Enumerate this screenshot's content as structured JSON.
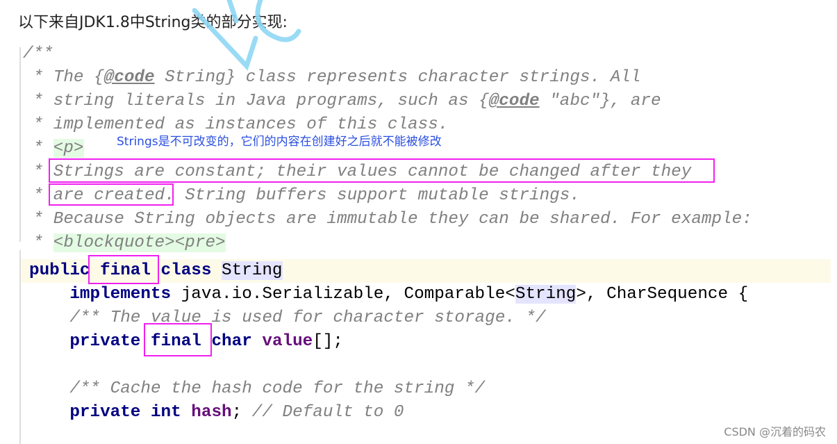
{
  "intro": "以下来自JDK1.8中String类的部分实现:",
  "annotation": "Strings是不可改变的，它们的内容在创建好之后就不能被修改",
  "footer": "CSDN @沉着的码农",
  "colors": {
    "highlight_box": "#f020f0",
    "annotation": "#2a4fe0",
    "keyword": "#000080",
    "comment": "#808080",
    "field": "#660e7a"
  },
  "javadoc": [
    [
      {
        "t": "/**",
        "c": "cm"
      }
    ],
    [
      {
        "t": " * The ",
        "c": "cm"
      },
      {
        "t": "{",
        "c": "cm"
      },
      {
        "t": "@code",
        "c": "tag"
      },
      {
        "t": " String} class represents character strings. All",
        "c": "cm"
      }
    ],
    [
      {
        "t": " * string literals in Java programs, such as {",
        "c": "cm"
      },
      {
        "t": "@code",
        "c": "tag"
      },
      {
        "t": " \"abc\"}, are",
        "c": "cm"
      }
    ],
    [
      {
        "t": " * implemented as instances of this class.",
        "c": "cm"
      }
    ],
    [
      {
        "t": " * ",
        "c": "cm"
      },
      {
        "t": "<p>",
        "c": "cm hl-green"
      }
    ],
    [
      {
        "t": " * Strings are constant; their values cannot be changed after they",
        "c": "cm"
      }
    ],
    [
      {
        "t": " * are created. String buffers support mutable strings.",
        "c": "cm"
      }
    ],
    [
      {
        "t": " * Because String objects are immutable they can be shared. For example:",
        "c": "cm"
      }
    ],
    [
      {
        "t": " * ",
        "c": "cm"
      },
      {
        "t": "<blockquote><pre>",
        "c": "cm hl-green"
      }
    ]
  ],
  "code": [
    [
      {
        "t": "public final class ",
        "c": "kw"
      },
      {
        "t": "String",
        "c": "pl hl-type"
      }
    ],
    [
      {
        "t": "    implements ",
        "c": "kw"
      },
      {
        "t": "java.io.Serializable, Comparable<",
        "c": "pl"
      },
      {
        "t": "String",
        "c": "pl hl-type"
      },
      {
        "t": ">, CharSequence {",
        "c": "pl"
      }
    ],
    [
      {
        "t": "    /** The value is used for character storage. */",
        "c": "cm"
      }
    ],
    [
      {
        "t": "    private final char ",
        "c": "kw"
      },
      {
        "t": "value",
        "c": "fld"
      },
      {
        "t": "[];",
        "c": "pl"
      }
    ],
    [
      {
        "t": "",
        "c": "pl"
      }
    ],
    [
      {
        "t": "    /** Cache the hash code for the string */",
        "c": "cm"
      }
    ],
    [
      {
        "t": "    private int ",
        "c": "kw"
      },
      {
        "t": "hash",
        "c": "fld"
      },
      {
        "t": "; ",
        "c": "pl"
      },
      {
        "t": "// Default to 0",
        "c": "cm"
      }
    ]
  ]
}
